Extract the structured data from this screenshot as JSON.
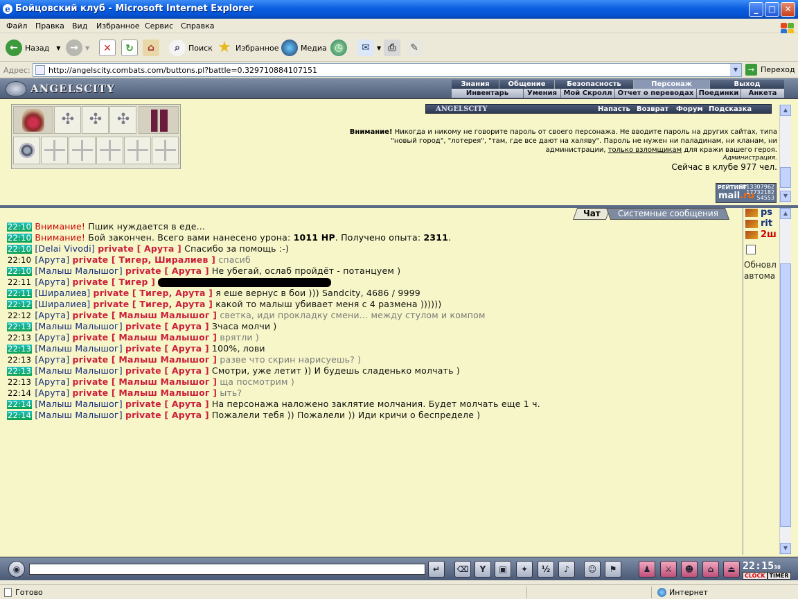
{
  "window": {
    "title": "Бойцовский клуб - Microsoft Internet Explorer",
    "min": "_",
    "max": "□",
    "close": "✕"
  },
  "menu": [
    "Файл",
    "Правка",
    "Вид",
    "Избранное",
    "Сервис",
    "Справка"
  ],
  "toolbar": {
    "back": "Назад",
    "search": "Поиск",
    "favorites": "Избранное",
    "media": "Медиа"
  },
  "address": {
    "label": "Адрес:",
    "url": "http://angelscity.combats.com/buttons.pl?battle=0.329710884107151",
    "go": "Переход"
  },
  "game": {
    "logo": "ANGELSCITY",
    "nav_top": [
      "Знания",
      "Общение",
      "Безопасность",
      "Персонаж",
      "Выход"
    ],
    "nav_bottom": [
      "Инвентарь",
      "Умения",
      "Мой Скролл",
      "Отчет о переводах",
      "Поединки",
      "Анкета"
    ],
    "info_links": [
      "Напасть",
      "Возврат",
      "Форум",
      "Подсказка"
    ],
    "warning_bold": "Внимание!",
    "warning_line1": "Никогда и никому не говорите пароль от своего персонажа. Не вводите пароль на других сайтах, типа",
    "warning_line2": "\"новый город\", \"лотерея\", \"там, где все дают на халяву\". Пароль не нужен ни паладинам, ни кланам, ни",
    "warning_line3_a": "администрации,",
    "warning_line3_link": "только взломщикам",
    "warning_line3_b": "для кражи вашего героя.",
    "admin": "Администрация.",
    "online": "Сейчас в клубе 977 чел.",
    "rating": {
      "label": "РЕЙТИНГ",
      "brand_a": "mail",
      "brand_b": ".ru",
      "n1": "8813307962",
      "n2": "17732182",
      "n3": "54553"
    },
    "tab_chat": "Чат",
    "tab_system": "Системные сообщения",
    "right_names": [
      "ps",
      "rit",
      "2ш"
    ],
    "right_refresh": "Обновл",
    "right_auto": "автома",
    "clock": {
      "time": "22:15",
      "sec": "30",
      "clock_label": "CLOCK",
      "timer_label": "TIMER"
    }
  },
  "chat": [
    {
      "time": "22:10",
      "hl": true,
      "type": "sys",
      "label": "Внимание!",
      "text": "Пшик нуждается в еде..."
    },
    {
      "time": "22:10",
      "hl": true,
      "type": "sys2",
      "label": "Внимание!",
      "text": "Бой закончен. Всего вами нанесено урона:",
      "b1": "1011 HP",
      "mid": ". Получено опыта:",
      "b2": "2311",
      "end": "."
    },
    {
      "time": "22:10",
      "hl": true,
      "type": "pm",
      "sender": "[Delai Vivodi]",
      "to": "private [ Арута ]",
      "text": "Спасибо за помощь :-)",
      "grey": false
    },
    {
      "time": "22:10",
      "hl": false,
      "type": "pm",
      "sender": "[Арута]",
      "to": "private [ Тигер, Ширалиев ]",
      "text": "спасиб",
      "grey": true
    },
    {
      "time": "22:10",
      "hl": true,
      "type": "pm",
      "sender": "[Малыш Малышог]",
      "to": "private [ Арута ]",
      "text": "Не убегай, ослаб пройдёт - потанцуем )",
      "grey": false
    },
    {
      "time": "22:11",
      "hl": false,
      "type": "redact",
      "sender": "[Арута]",
      "to": "private [ Тигер ]"
    },
    {
      "time": "22:11",
      "hl": true,
      "type": "pm",
      "sender": "[Ширалиев]",
      "to": "private [ Тигер, Арута ]",
      "text": "я еше вернус в бои ))) Sandcity, 4686 / 9999",
      "grey": false
    },
    {
      "time": "22:12",
      "hl": true,
      "type": "pm",
      "sender": "[Ширалиев]",
      "to": "private [ Тигер, Арута ]",
      "text": "какой то малыш убивает меня с 4 размена ))))))",
      "grey": false
    },
    {
      "time": "22:12",
      "hl": false,
      "type": "pm",
      "sender": "[Арута]",
      "to": "private [ Малыш Малышог ]",
      "text": "светка, иди прокладку смени... между стулом и компом",
      "grey": true
    },
    {
      "time": "22:13",
      "hl": true,
      "type": "pm",
      "sender": "[Малыш Малышог]",
      "to": "private [ Арута ]",
      "text": "Зчаса молчи )",
      "grey": false
    },
    {
      "time": "22:13",
      "hl": false,
      "type": "pm",
      "sender": "[Арута]",
      "to": "private [ Малыш Малышог ]",
      "text": "врятли )",
      "grey": true
    },
    {
      "time": "22:13",
      "hl": true,
      "type": "pm",
      "sender": "[Малыш Малышог]",
      "to": "private [ Арута ]",
      "text": "100%, лови",
      "grey": false
    },
    {
      "time": "22:13",
      "hl": false,
      "type": "pm",
      "sender": "[Арута]",
      "to": "private [ Малыш Малышог ]",
      "text": "разве что скрин нарисуешь? )",
      "grey": true
    },
    {
      "time": "22:13",
      "hl": true,
      "type": "pm",
      "sender": "[Малыш Малышог]",
      "to": "private [ Арута ]",
      "text": "Смотри, уже летит )) И будешь сладенько молчать )",
      "grey": false
    },
    {
      "time": "22:13",
      "hl": false,
      "type": "pm",
      "sender": "[Арута]",
      "to": "private [ Малыш Малышог ]",
      "text": "ща посмотрим )",
      "grey": true
    },
    {
      "time": "22:14",
      "hl": false,
      "type": "pm",
      "sender": "[Арута]",
      "to": "private [ Малыш Малышог ]",
      "text": "ыть?",
      "grey": true
    },
    {
      "time": "22:14",
      "hl": true,
      "type": "pm",
      "sender": "[Малыш Малышог]",
      "to": "private [ Арута ]",
      "text": "На персонажа наложено заклятие молчания. Будет молчать еще 1 ч.",
      "grey": false
    },
    {
      "time": "22:14",
      "hl": true,
      "type": "pm",
      "sender": "[Малыш Малышог]",
      "to": "private [ Арута ]",
      "text": "Пожалели тебя )) Пожалели )) Иди кричи о беспределе )",
      "grey": false
    }
  ],
  "status": {
    "left": "Готово",
    "right": "Интернет"
  }
}
